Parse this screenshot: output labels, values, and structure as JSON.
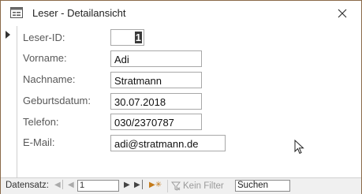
{
  "window": {
    "title": "Leser - Detailansicht",
    "title_icon": "form-icon",
    "close_icon": "close-icon"
  },
  "form": {
    "fields": [
      {
        "label": "Leser-ID:",
        "value": "1"
      },
      {
        "label": "Vorname:",
        "value": "Adi"
      },
      {
        "label": "Nachname:",
        "value": "Stratmann"
      },
      {
        "label": "Geburtsdatum:",
        "value": "30.07.2018"
      },
      {
        "label": "Telefon:",
        "value": "030/2370787"
      },
      {
        "label": "E-Mail:",
        "value": "adi@stratmann.de"
      }
    ]
  },
  "navigation": {
    "label": "Datensatz:",
    "current_record": "1",
    "filter_label": "Kein Filter",
    "search_placeholder": "Suchen",
    "first_icon": "first-record-icon",
    "prev_icon": "previous-record-icon",
    "next_icon": "next-record-icon",
    "last_icon": "last-record-icon",
    "new_icon": "new-record-icon",
    "filter_icon": "filter-icon"
  },
  "colors": {
    "window_border": "#8a6a4a",
    "navbar_bg": "#f0f0f0",
    "label_text": "#595959"
  }
}
